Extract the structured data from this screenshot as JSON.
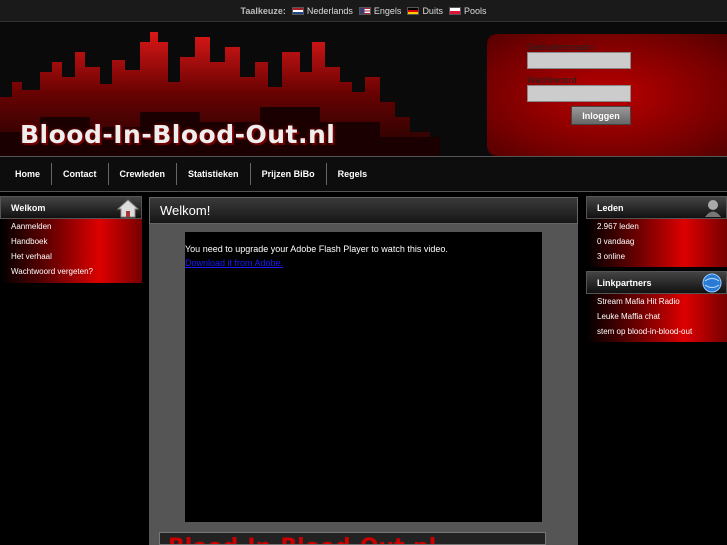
{
  "langbar": {
    "label": "Taalkeuze:",
    "languages": [
      {
        "label": "Nederlands",
        "flag": "flag-nl"
      },
      {
        "label": "Engels",
        "flag": "flag-en"
      },
      {
        "label": "Duits",
        "flag": "flag-de"
      },
      {
        "label": "Pools",
        "flag": "flag-pl"
      }
    ]
  },
  "header": {
    "logo": "Blood-In-Blood-Out.nl"
  },
  "login": {
    "username_label": "Gebruikersnaam",
    "password_label": "Wachtwoord",
    "button": "Inloggen"
  },
  "nav": [
    "Home",
    "Contact",
    "Crewleden",
    "Statistieken",
    "Prijzen BiBo",
    "Regels"
  ],
  "left": {
    "title": "Welkom",
    "icon": "house-icon",
    "links": [
      "Aanmelden",
      "Handboek",
      "Het verhaal",
      "Wachtwoord vergeten?"
    ]
  },
  "main": {
    "title": "Welkom!",
    "flash_message": "You need to upgrade your Adobe Flash Player to watch this video.",
    "flash_link": "Download it from Adobe.",
    "banner": "Blood-In-Blood-Out.nl"
  },
  "right": {
    "leden": {
      "title": "Leden",
      "icon": "member-icon",
      "stats": [
        "2.967 leden",
        "0 vandaag",
        "3 online"
      ]
    },
    "linkpartners": {
      "title": "Linkpartners",
      "icon": "globe-icon",
      "links": [
        "Stream Mafia Hit Radio",
        "Leuke Maffia chat",
        "stem op blood-in-blood-out"
      ]
    }
  },
  "colors": {
    "accent": "#cc0000",
    "background": "#000000"
  }
}
